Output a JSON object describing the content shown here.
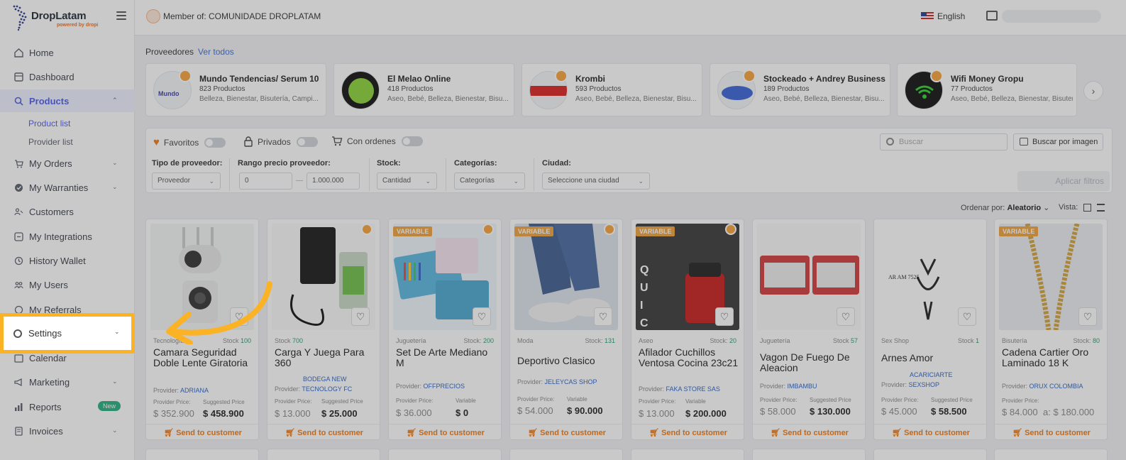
{
  "app": {
    "brand": "DropLatam",
    "brand_sub": "powered by dropi",
    "member_text": "Member of: COMUNIDADE DROPLATAM",
    "language": "English"
  },
  "sidebar": {
    "items": [
      {
        "label": "Home",
        "icon": "home-icon"
      },
      {
        "label": "Dashboard",
        "icon": "dashboard-icon"
      },
      {
        "label": "Products",
        "icon": "search-icon"
      },
      {
        "label": "My Orders",
        "icon": "cart-icon"
      },
      {
        "label": "My Warranties",
        "icon": "shield-check-icon"
      },
      {
        "label": "Customers",
        "icon": "users-icon"
      },
      {
        "label": "My Integrations",
        "icon": "integration-icon"
      },
      {
        "label": "History Wallet",
        "icon": "history-icon"
      },
      {
        "label": "My Users",
        "icon": "user-group-icon"
      },
      {
        "label": "My Referrals",
        "icon": "referral-icon"
      },
      {
        "label": "Settings",
        "icon": "gear-icon"
      },
      {
        "label": "Calendar",
        "icon": "calendar-icon"
      },
      {
        "label": "Marketing",
        "icon": "megaphone-icon"
      },
      {
        "label": "Reports",
        "icon": "chart-icon",
        "badge": "New"
      },
      {
        "label": "Invoices",
        "icon": "invoice-icon"
      }
    ],
    "sub_products": [
      "Product list",
      "Provider list"
    ]
  },
  "providers": {
    "title": "Proveedores",
    "view_all": "Ver todos",
    "cards": [
      {
        "name": "Mundo Tendencias/ Serum 10",
        "count": "823 Productos",
        "cats": "Belleza, Bienestar, Bisutería, Campi..."
      },
      {
        "name": "El Melao Online",
        "count": "418 Productos",
        "cats": "Aseo, Bebé, Belleza, Bienestar, Bisu..."
      },
      {
        "name": "Krombi",
        "count": "593 Productos",
        "cats": "Aseo, Bebé, Belleza, Bienestar, Bisu..."
      },
      {
        "name": "Stockeado + Andrey Business",
        "count": "189 Productos",
        "cats": "Aseo, Bebé, Belleza, Bienestar, Bisu..."
      },
      {
        "name": "Wifi Money Gropu",
        "count": "77 Productos",
        "cats": "Aseo, Bebé, Belleza, Bienestar, Bisutería, ..."
      }
    ]
  },
  "filters": {
    "favoritos": "Favoritos",
    "privados": "Privados",
    "con_ordenes": "Con ordenes",
    "search_placeholder": "Buscar",
    "image_search": "Buscar por imagen",
    "tipo_label": "Tipo de proveedor:",
    "tipo_value": "Proveedor",
    "rango_label": "Rango precio proveedor:",
    "rango_min": "0",
    "rango_max": "1.000.000",
    "stock_label": "Stock:",
    "stock_value": "Cantidad",
    "cat_label": "Categorías:",
    "cat_value": "Categorías",
    "ciudad_label": "Ciudad:",
    "ciudad_value": "Seleccione una ciudad",
    "apply": "Aplicar filtros",
    "sort_label": "Ordenar por:",
    "sort_value": "Aleatorio",
    "vista_label": "Vista:"
  },
  "products": [
    {
      "cat": "Tecnología",
      "stock_label": "Stock",
      "stock": "100",
      "name": "Camara Seguridad Doble Lente Giratoria",
      "provider": "ADRIANA",
      "price": "$ 352.900",
      "suggested": "$ 458.900",
      "variable": false
    },
    {
      "cat": "",
      "stock_label": "Stock",
      "stock": "700",
      "name": "Carga Y Juega Para 360",
      "provider_top": "BODEGA NEW",
      "provider": "TECNOLOGY FC",
      "price": "$ 13.000",
      "suggested": "$ 25.000",
      "variable": false
    },
    {
      "cat": "Juguetería",
      "stock_label": "Stock:",
      "stock": "200",
      "name": "Set De Arte Mediano M",
      "provider": "OFFPRECIOS",
      "price": "$ 36.000",
      "suggested": "$ 0",
      "variable": true
    },
    {
      "cat": "Moda",
      "stock_label": "Stock:",
      "stock": "131",
      "name": "Deportivo Clasico",
      "provider": "JELEYCAS SHOP",
      "price": "$ 54.000",
      "suggested": "$ 90.000",
      "variable": true
    },
    {
      "cat": "Aseo",
      "stock_label": "Stock:",
      "stock": "20",
      "name": "Afilador Cuchillos Ventosa Cocina 23c21",
      "provider": "FAKA STORE SAS",
      "price": "$ 13.000",
      "suggested": "$ 200.000",
      "variable": true
    },
    {
      "cat": "Juguetería",
      "stock_label": "Stock",
      "stock": "57",
      "name": "Vagon De Fuego De Aleacion",
      "provider": "IMBAMBU",
      "price": "$ 58.000",
      "suggested": "$ 130.000",
      "variable": false
    },
    {
      "cat": "Sex Shop",
      "stock_label": "Stock",
      "stock": "1",
      "name": "Arnes Amor",
      "provider_top": "ACARICIARTE",
      "provider": "SEXSHOP",
      "price": "$ 45.000",
      "suggested": "$ 58.500",
      "variable": false
    },
    {
      "cat": "Bisutería",
      "stock_label": "Stock:",
      "stock": "80",
      "name": "Cadena Cartier Oro Laminado 18 K",
      "provider": "ORUX COLOMBIA",
      "price": "$ 84.000",
      "suggested": "a: $ 180.000",
      "variable": true
    }
  ],
  "product_labels": {
    "provider": "Provider:",
    "provider_price": "Provider Price:",
    "suggested_price": "Suggested Price",
    "variable_price": "Variable",
    "variable_badge": "VARIABLE",
    "send": "Send to customer"
  },
  "colors": {
    "accent": "#fbb325",
    "primary": "#4e5ee8",
    "send": "#f07a14"
  }
}
